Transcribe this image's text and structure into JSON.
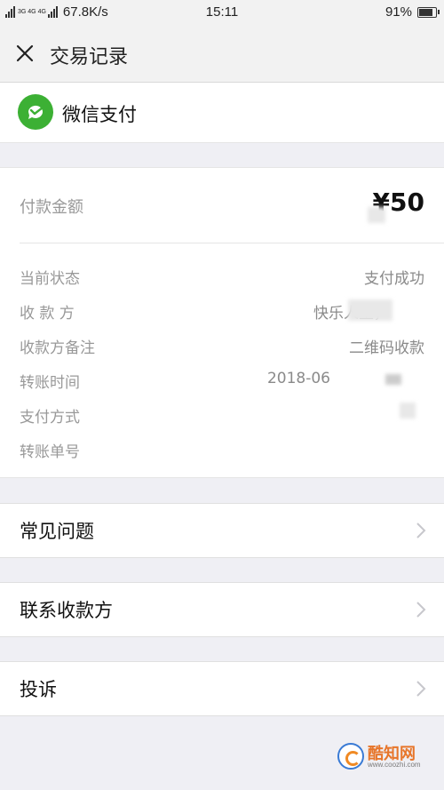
{
  "status_bar": {
    "network": "3G 4G 4G",
    "speed": "67.8K/s",
    "time": "15:11",
    "battery": "91%",
    "battery_level": 0.91
  },
  "nav": {
    "close_icon": "close-icon",
    "title": "交易记录"
  },
  "merchant": {
    "logo": "wechat-pay-icon",
    "name": "微信支付",
    "brand_color": "#3cb034"
  },
  "payment": {
    "amount_label": "付款金额",
    "amount_value": "¥50",
    "rows": [
      {
        "label": "当前状态",
        "value": "支付成功"
      },
      {
        "label": "收 款 方",
        "value": "快乐人生，"
      },
      {
        "label": "收款方备注",
        "value": "二维码收款"
      },
      {
        "label": "转账时间",
        "value": "2018-06"
      },
      {
        "label": "支付方式",
        "value": ""
      },
      {
        "label": "转账单号",
        "value": ""
      }
    ]
  },
  "menu": [
    {
      "label": "常见问题",
      "icon": "chevron-right-icon"
    },
    {
      "label": "联系收款方",
      "icon": "chevron-right-icon"
    },
    {
      "label": "投诉",
      "icon": "chevron-right-icon"
    }
  ],
  "watermark": {
    "text": "酷知网",
    "url": "www.coozhi.com"
  }
}
